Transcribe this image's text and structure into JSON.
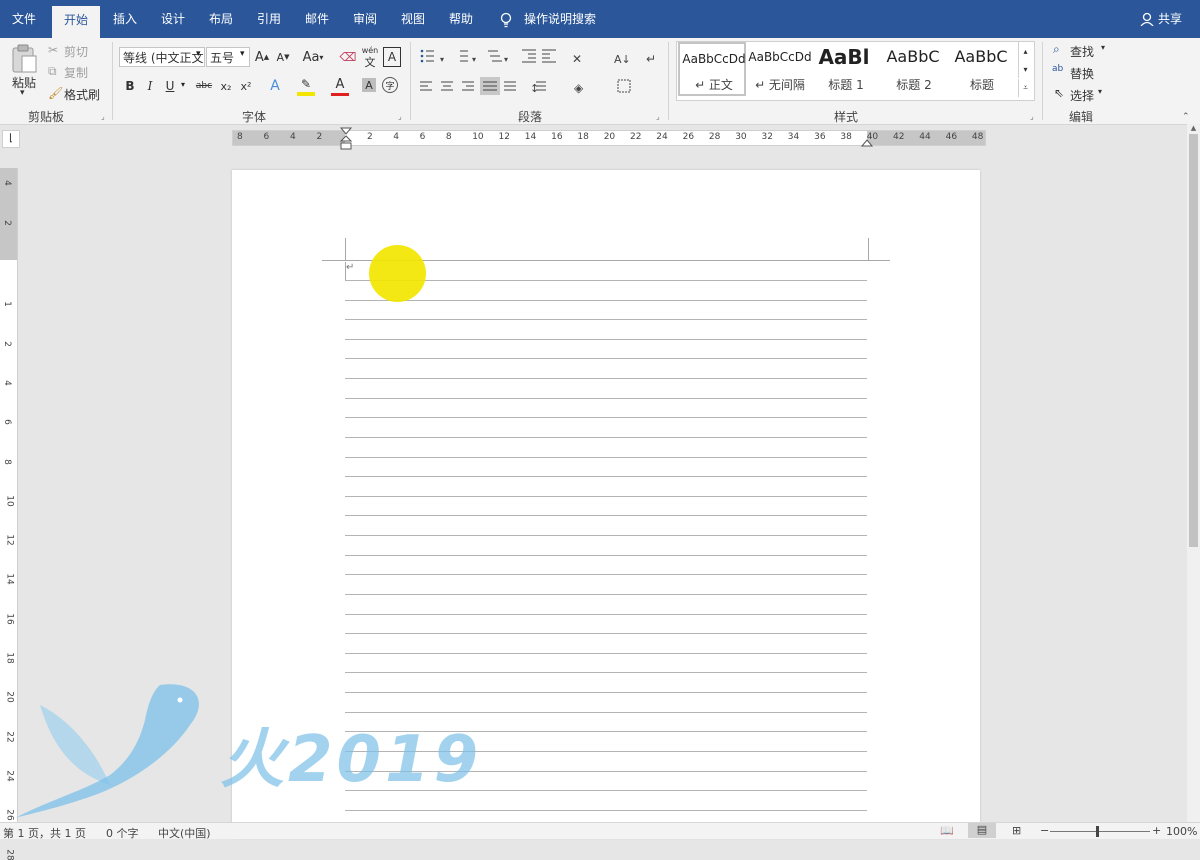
{
  "tabs": [
    "文件",
    "开始",
    "插入",
    "设计",
    "布局",
    "引用",
    "邮件",
    "审阅",
    "视图",
    "帮助"
  ],
  "tell_me": "操作说明搜索",
  "share": "共享",
  "clipboard": {
    "paste": "粘贴",
    "cut": "剪切",
    "copy": "复制",
    "format_painter": "格式刷",
    "group": "剪贴板"
  },
  "font": {
    "font_name": "等线 (中文正文)",
    "font_size": "五号",
    "change_case": "Aa",
    "wen": "wén",
    "wen_char": "文",
    "border_char": "A",
    "bold": "B",
    "italic": "I",
    "underline": "U",
    "strike": "abc",
    "sub": "x₂",
    "sup": "x²",
    "a": "A",
    "group": "字体"
  },
  "paragraph": {
    "group": "段落"
  },
  "styles": {
    "items": [
      {
        "sample": "AaBbCcDd",
        "name": "↵ 正文"
      },
      {
        "sample": "AaBbCcDd",
        "name": "↵ 无间隔"
      },
      {
        "sample": "AaBl",
        "name": "标题 1"
      },
      {
        "sample": "AaBbC",
        "name": "标题 2"
      },
      {
        "sample": "AaBbC",
        "name": "标题"
      }
    ],
    "group": "样式"
  },
  "editing": {
    "find": "查找",
    "replace": "替换",
    "select": "选择",
    "group": "编辑"
  },
  "hruler": [
    "8",
    "6",
    "4",
    "2",
    "2",
    "4",
    "6",
    "8",
    "10",
    "12",
    "14",
    "16",
    "18",
    "20",
    "22",
    "24",
    "26",
    "28",
    "30",
    "32",
    "34",
    "36",
    "38",
    "40",
    "42",
    "44",
    "46",
    "48"
  ],
  "vruler": [
    "4",
    "2",
    "1",
    "2",
    "4",
    "6",
    "8",
    "10",
    "12",
    "14",
    "16",
    "18",
    "20",
    "22",
    "24",
    "26",
    "28"
  ],
  "paragraph_mark": "↵",
  "watermark": "火2019",
  "status": {
    "page": "第 1 页，共 1 页",
    "words": "0 个字",
    "lang": "中文(中国)",
    "zoom": "100%"
  },
  "colors": {
    "accent": "#2b579a",
    "highlight": "#f2e600",
    "ribbon": "#f3f3f3"
  }
}
